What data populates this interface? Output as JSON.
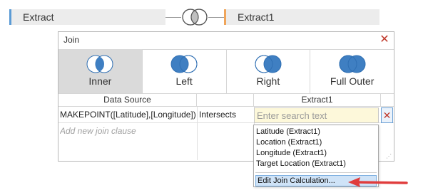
{
  "canvas": {
    "left_table": "Extract",
    "right_table": "Extract1"
  },
  "dialog": {
    "title": "Join",
    "join_types": [
      {
        "label": "Inner",
        "selected": true
      },
      {
        "label": "Left",
        "selected": false
      },
      {
        "label": "Right",
        "selected": false
      },
      {
        "label": "Full Outer",
        "selected": false
      }
    ],
    "columns": {
      "data_source": "Data Source",
      "right": "Extract1"
    },
    "clause": {
      "left_field": "MAKEPOINT([Latitude],[Longitude])",
      "operator": "Intersects",
      "right_placeholder": "Enter search text"
    },
    "add_clause": "Add new join clause"
  },
  "dropdown": {
    "items": [
      "Latitude (Extract1)",
      "Location (Extract1)",
      "Longitude (Extract1)",
      "Target Location (Extract1)"
    ],
    "edit": "Edit Join Calculation..."
  },
  "colors": {
    "venn_blue": "#3f7fc2",
    "left_accent": "#5b9bd5",
    "right_accent": "#f0a55a",
    "annotation_red": "#e03c3c"
  }
}
